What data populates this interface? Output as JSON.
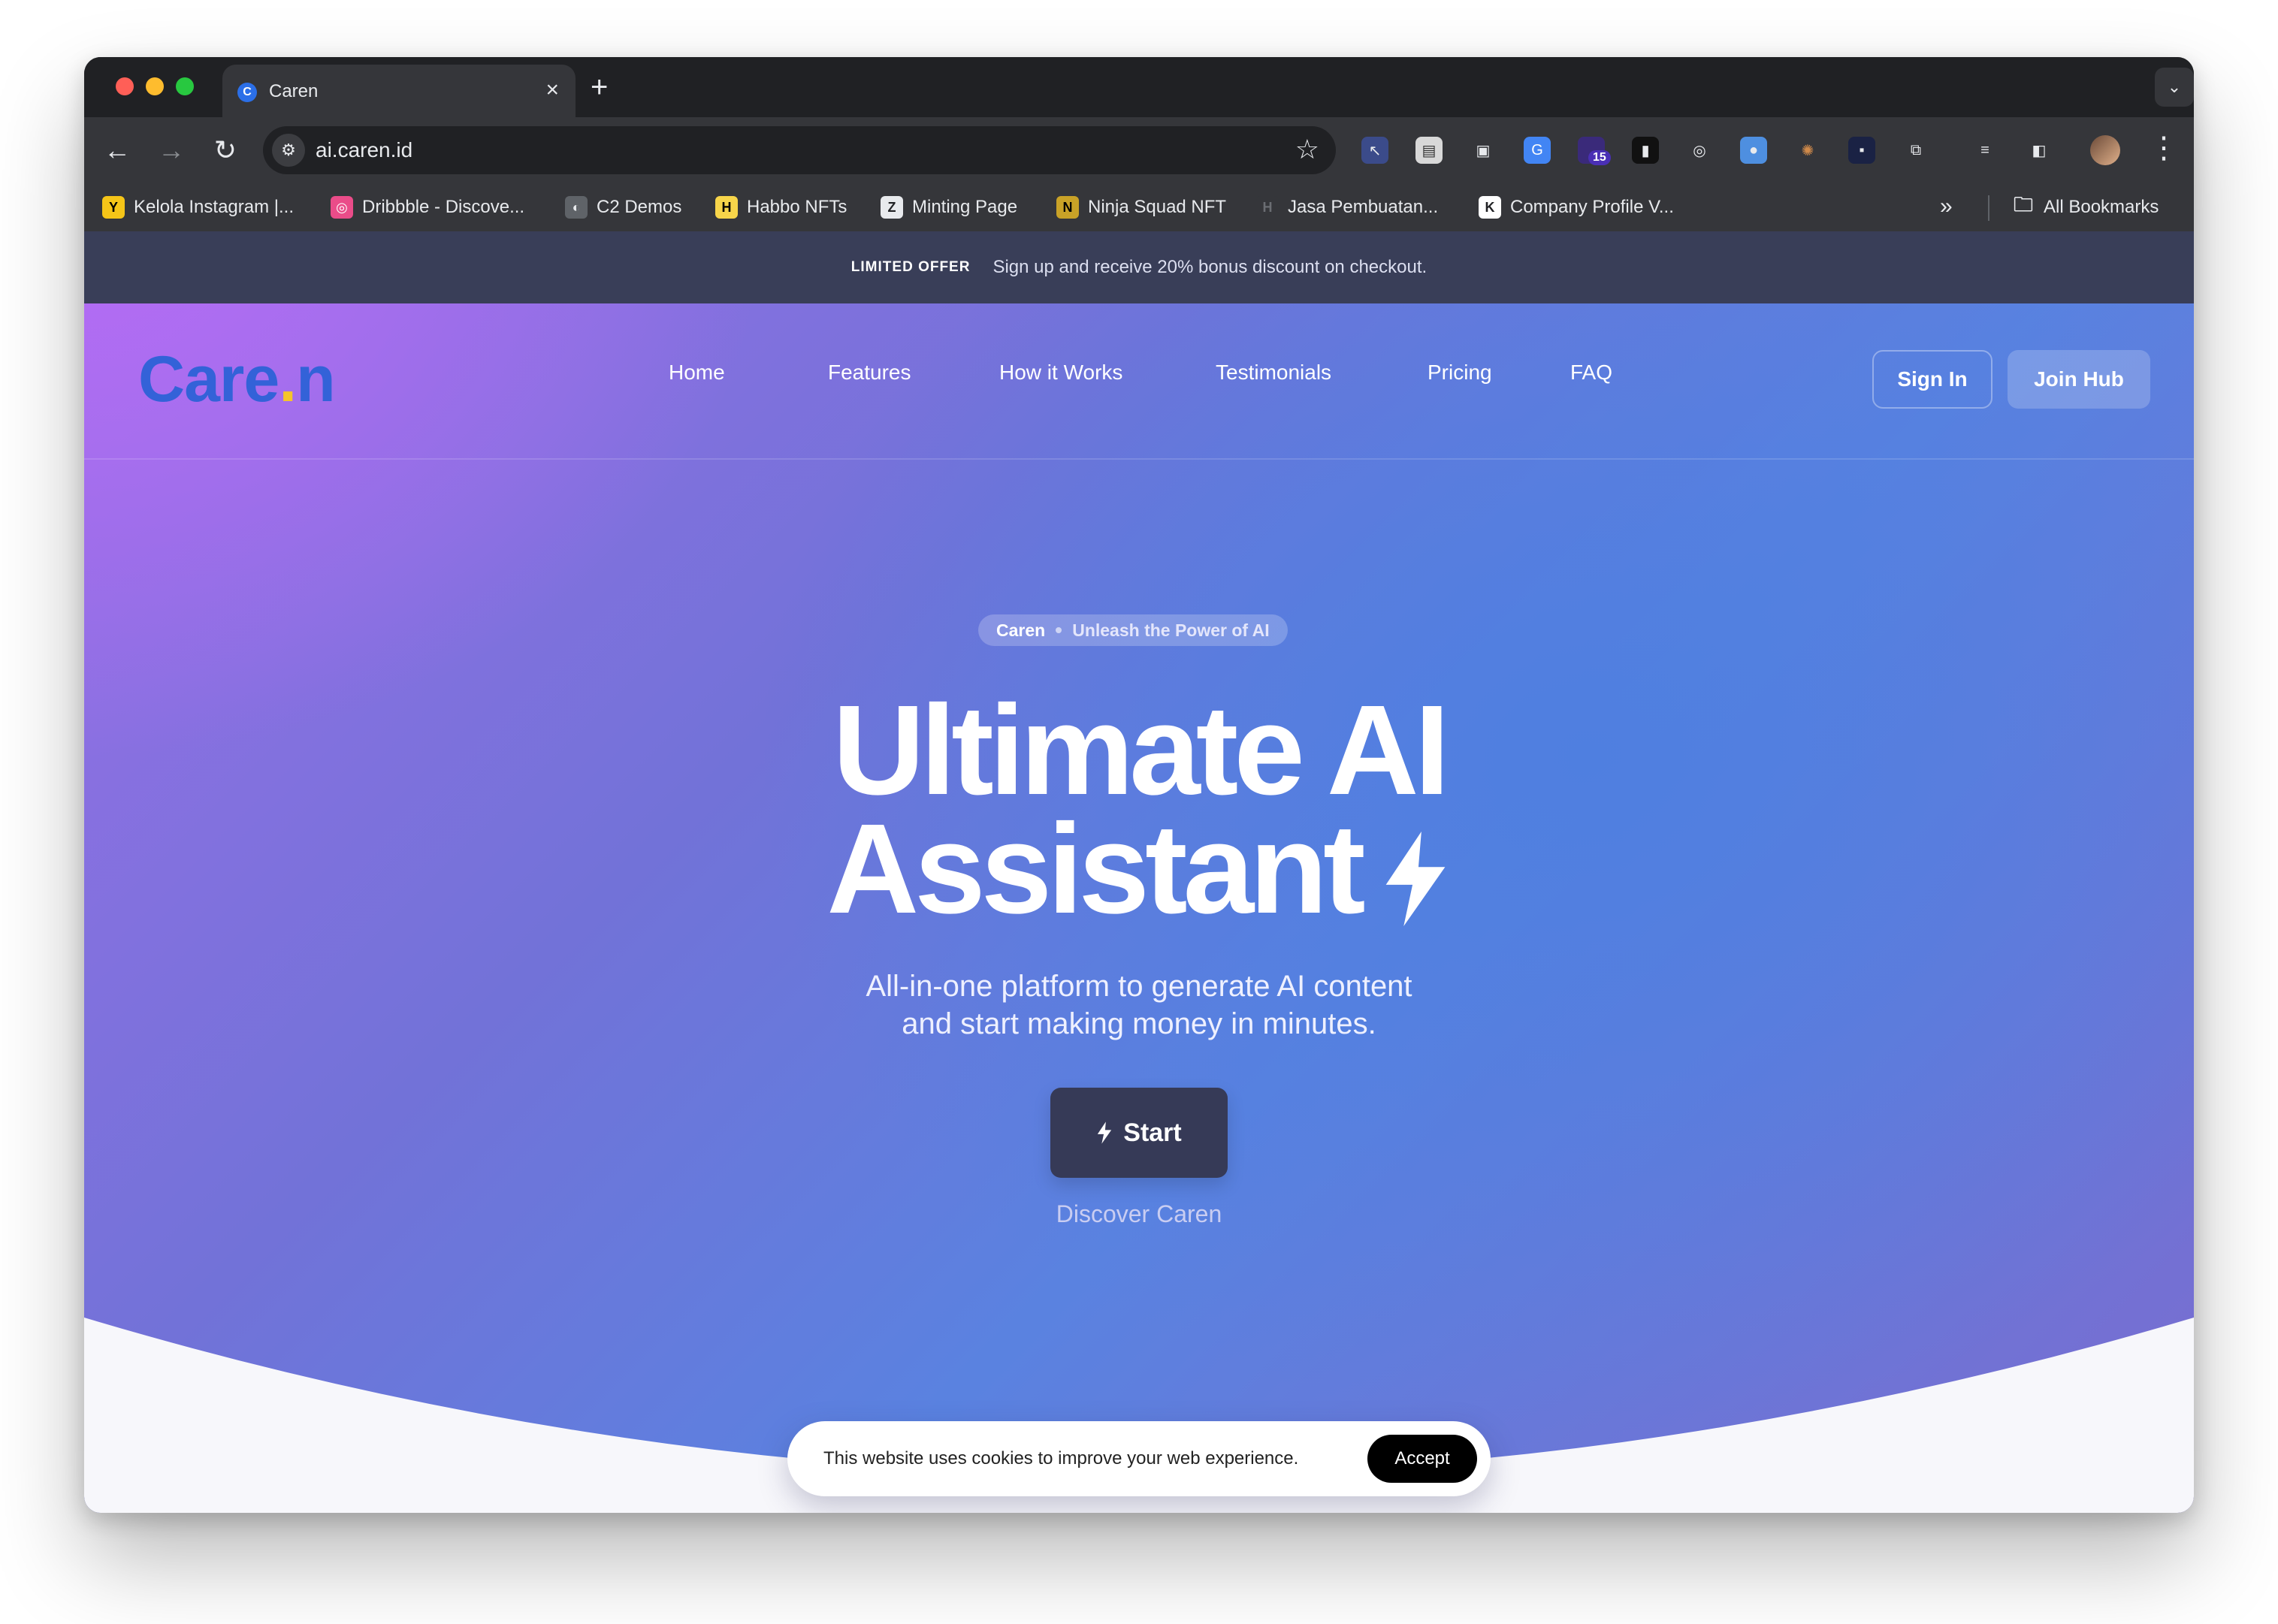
{
  "browser": {
    "tab_title": "Caren",
    "tab_favicon": "C",
    "url": "ai.caren.id",
    "extension_badge": "15",
    "bookmarks": [
      {
        "label": "Kelola Instagram |...",
        "icon": "Y",
        "bg": "#f5c518",
        "fg": "#000000"
      },
      {
        "label": "Dribbble - Discove...",
        "icon": "◎",
        "bg": "#ea4c89",
        "fg": "#ffffff"
      },
      {
        "label": "C2 Demos",
        "icon": "◐",
        "bg": "#5f6368",
        "fg": "#e8eaed"
      },
      {
        "label": "Habbo NFTs",
        "icon": "H",
        "bg": "#f7d54a",
        "fg": "#000000"
      },
      {
        "label": "Minting Page",
        "icon": "Z",
        "bg": "#e8eaed",
        "fg": "#202124"
      },
      {
        "label": "Ninja Squad NFT",
        "icon": "N",
        "bg": "#c9a227",
        "fg": "#000000"
      },
      {
        "label": "Jasa Pembuatan...",
        "icon": "H",
        "bg": "#35363a",
        "fg": "#6b6e73"
      },
      {
        "label": "Company Profile V...",
        "icon": "K",
        "bg": "#ffffff",
        "fg": "#202124"
      }
    ],
    "all_bookmarks_label": "All Bookmarks"
  },
  "offer": {
    "tag": "LIMITED OFFER",
    "text": "Sign up and receive 20% bonus discount on checkout."
  },
  "nav": {
    "logo_main": "Care",
    "logo_dot": ".",
    "logo_end": "n",
    "links": [
      "Home",
      "Features",
      "How it Works",
      "Testimonials",
      "Pricing",
      "FAQ"
    ],
    "sign_in": "Sign In",
    "join": "Join Hub"
  },
  "hero": {
    "pill_brand": "Caren",
    "pill_tag": "Unleash the Power of AI",
    "headline_line1": "Ultimate AI",
    "headline_line2": "Assistant",
    "subtitle_line1": "All-in-one platform to generate AI content",
    "subtitle_line2": "and start making money in minutes.",
    "start_label": "Start",
    "discover_label": "Discover Caren"
  },
  "cookie": {
    "text": "This website uses cookies to improve your web experience.",
    "accept": "Accept"
  }
}
